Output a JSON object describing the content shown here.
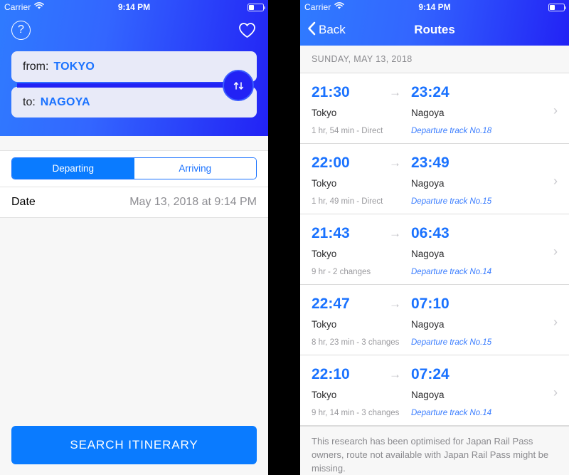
{
  "status_bar": {
    "carrier": "Carrier",
    "time": "9:14 PM",
    "wifi_icon": "wifi-icon",
    "battery_icon": "battery-icon"
  },
  "colors": {
    "accent_blue": "#0a7bff",
    "link_blue": "#1a72ff",
    "header_gradient_start": "#2f7bff",
    "header_gradient_end": "#2222f5",
    "field_background": "#e8eaf8",
    "muted_gray": "#8e8e93",
    "page_background": "#f7f7f7",
    "divider": "#dcdcdc"
  },
  "search_screen": {
    "help_button_label": "?",
    "favorites_icon": "heart-icon",
    "from_field": {
      "label": "from:",
      "value": "TOKYO"
    },
    "to_field": {
      "label": "to:",
      "value": "NAGOYA"
    },
    "swap_icon": "swap-vertical-icon",
    "segmented_control": {
      "options": [
        {
          "label": "Departing",
          "selected": true
        },
        {
          "label": "Arriving",
          "selected": false
        }
      ]
    },
    "date_row": {
      "label": "Date",
      "value": "May 13, 2018 at 9:14 PM"
    },
    "search_button_label": "SEARCH ITINERARY"
  },
  "routes_screen": {
    "back_label": "Back",
    "back_icon": "chevron-left-icon",
    "title": "Routes",
    "section_header": "SUNDAY, MAY 13, 2018",
    "arrow_icon": "arrow-right-icon",
    "disclosure_icon": "chevron-right-icon",
    "routes": [
      {
        "depart_time": "21:30",
        "arrive_time": "23:24",
        "origin": "Tokyo",
        "destination": "Nagoya",
        "duration": "1 hr, 54 min - Direct",
        "track": "Departure track No.18"
      },
      {
        "depart_time": "22:00",
        "arrive_time": "23:49",
        "origin": "Tokyo",
        "destination": "Nagoya",
        "duration": "1 hr, 49 min - Direct",
        "track": "Departure track No.15"
      },
      {
        "depart_time": "21:43",
        "arrive_time": "06:43",
        "origin": "Tokyo",
        "destination": "Nagoya",
        "duration": "9 hr - 2 changes",
        "track": "Departure track No.14"
      },
      {
        "depart_time": "22:47",
        "arrive_time": "07:10",
        "origin": "Tokyo",
        "destination": "Nagoya",
        "duration": "8 hr, 23 min - 3 changes",
        "track": "Departure track No.15"
      },
      {
        "depart_time": "22:10",
        "arrive_time": "07:24",
        "origin": "Tokyo",
        "destination": "Nagoya",
        "duration": "9 hr, 14 min - 3 changes",
        "track": "Departure track No.14"
      }
    ],
    "footer_note": "This research has been optimised for Japan Rail Pass owners, route not available with Japan Rail Pass might be missing."
  }
}
